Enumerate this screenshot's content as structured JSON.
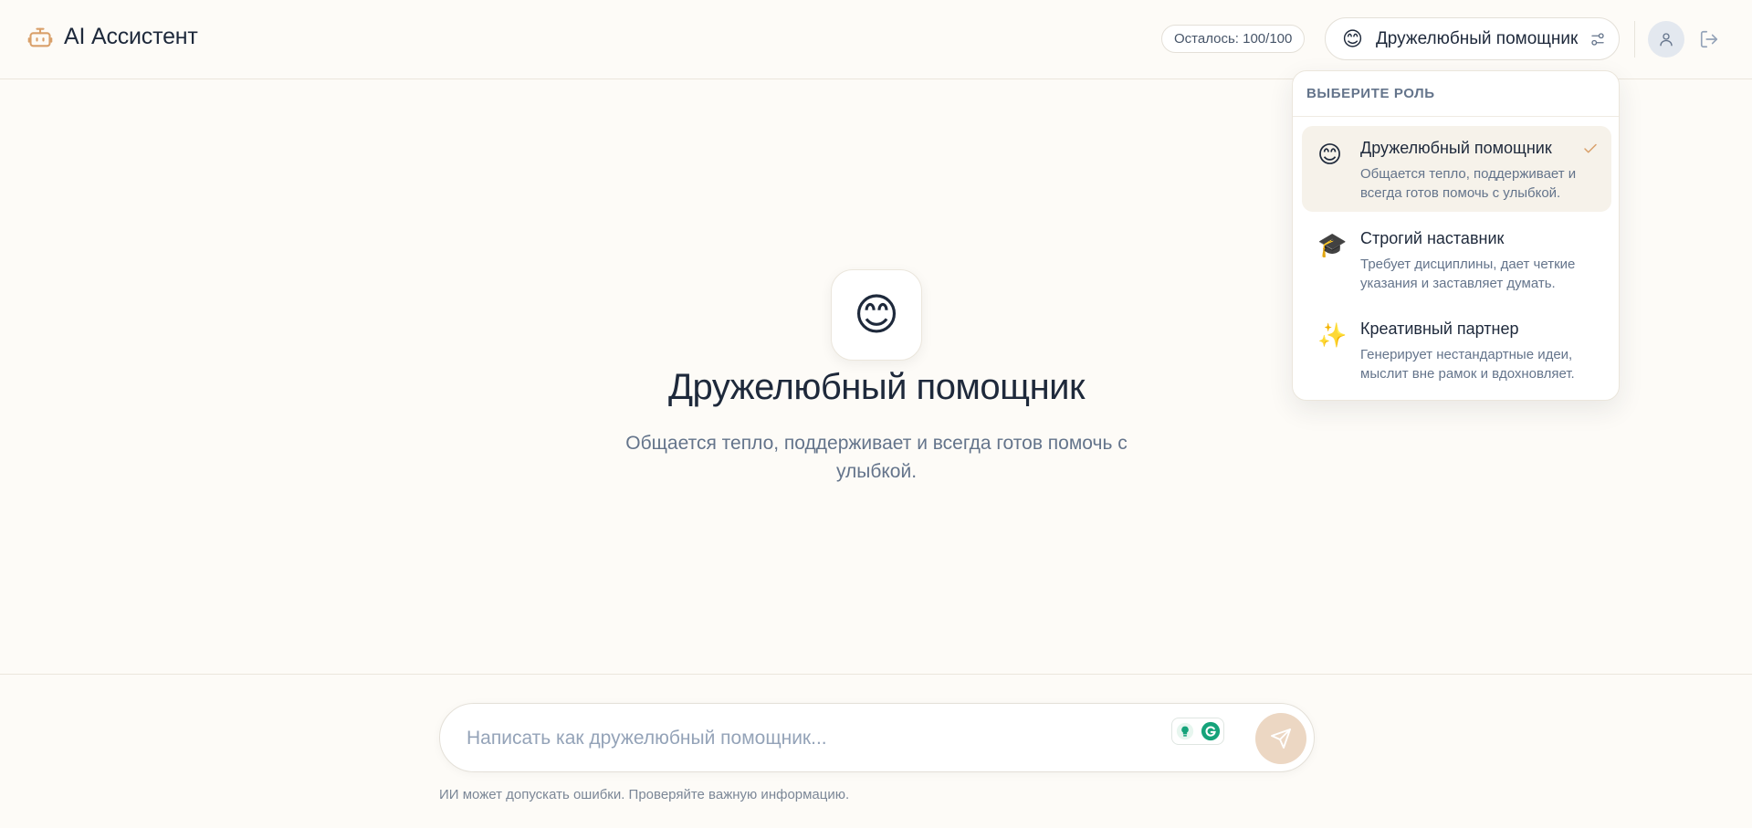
{
  "app": {
    "title": "AI Ассистент",
    "brand_color": "#d9a06a"
  },
  "header": {
    "quota": "Осталось: 100/100",
    "current_role": {
      "emoji": "😊",
      "label": "Дружелюбный помощник"
    }
  },
  "role_menu": {
    "title": "ВЫБЕРИТЕ РОЛЬ",
    "selected_index": 0,
    "items": [
      {
        "emoji": "😊",
        "name": "Дружелюбный помощник",
        "desc": "Общается тепло, поддерживает и всегда готов помочь с улыбкой."
      },
      {
        "emoji": "🎓",
        "name": "Строгий наставник",
        "desc": "Требует дисциплины, дает четкие указания и заставляет думать."
      },
      {
        "emoji": "✨",
        "name": "Креативный партнер",
        "desc": "Генерирует нестандартные идеи, мыслит вне рамок и вдохновляет."
      }
    ]
  },
  "hero": {
    "emoji": "😊",
    "title": "Дружелюбный помощник",
    "desc": "Общается тепло, поддерживает и всегда готов помочь с улыбкой."
  },
  "composer": {
    "placeholder": "Написать как дружелюбный помощник...",
    "value": ""
  },
  "footer": {
    "disclaimer": "ИИ может допускать ошибки. Проверяйте важную информацию."
  }
}
